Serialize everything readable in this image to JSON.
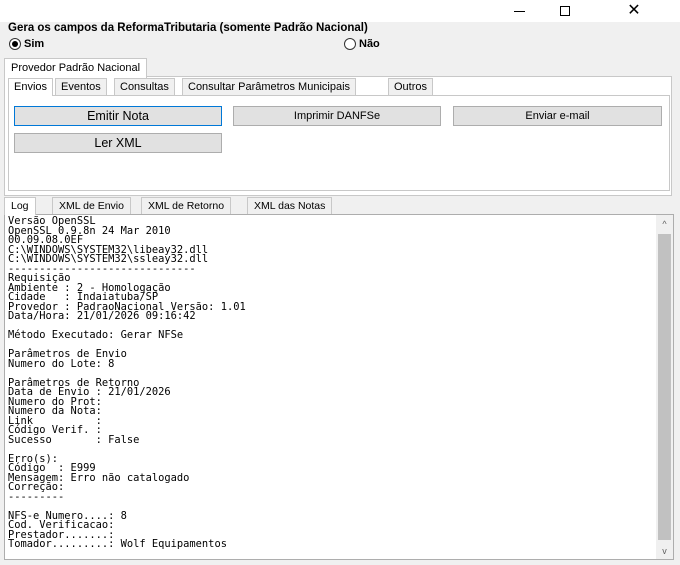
{
  "window": {
    "minimize_icon": "minimize-icon",
    "maximize_icon": "maximize-icon",
    "close_glyph": "✕"
  },
  "reforma": {
    "group_title": "Gera os campos da ReformaTributaria (somente Padrão Nacional)",
    "options": [
      {
        "label": "Sim",
        "selected": true
      },
      {
        "label": "Não",
        "selected": false
      }
    ]
  },
  "provider_tab": {
    "label": "Provedor Padrão Nacional"
  },
  "tabs": [
    {
      "label": "Envios",
      "active": true
    },
    {
      "label": "Eventos",
      "active": false
    },
    {
      "label": "Consultas",
      "active": false
    },
    {
      "label": "Consultar Parâmetros Municipais",
      "active": false
    },
    {
      "label": "Outros",
      "active": false
    }
  ],
  "buttons": {
    "emitir": "Emitir Nota",
    "imprimir": "Imprimir DANFSe",
    "enviar": "Enviar e-mail",
    "ler": "Ler XML"
  },
  "log_tabs": [
    {
      "label": "Log",
      "active": true
    },
    {
      "label": "XML de Envio",
      "active": false
    },
    {
      "label": "XML de Retorno",
      "active": false
    },
    {
      "label": "XML das Notas",
      "active": false
    }
  ],
  "log": {
    "lines": [
      "Versão OpenSSL",
      "OpenSSL 0.9.8n 24 Mar 2010",
      "00.09.08.0EF",
      "C:\\WINDOWS\\SYSTEM32\\libeay32.dll",
      "C:\\WINDOWS\\SYSTEM32\\ssleay32.dll",
      "------------------------------",
      "Requisição",
      "Ambiente : 2 - Homologação",
      "Cidade   : Indaiatuba/SP",
      "Provedor : PadraoNacional Versão: 1.01",
      "Data/Hora: 21/01/2026 09:16:42",
      "",
      "Método Executado: Gerar NFSe",
      "",
      "Parâmetros de Envio",
      "Numero do Lote: 8",
      "",
      "Parâmetros de Retorno",
      "Data de Envio : 21/01/2026",
      "Numero do Prot:",
      "Numero da Nota:",
      "Link          :",
      "Código Verif. :",
      "Sucesso       : False",
      "",
      "Erro(s):",
      "Código  : E999",
      "Mensagem: Erro não catalogado",
      "Correção:",
      "---------",
      "",
      "NFS-e Numero....: 8",
      "Cod. Verificacao:",
      "Prestador.......:",
      "Tomador.........: Wolf Equipamentos"
    ],
    "scroll_up_glyph": "^",
    "scroll_down_glyph": "v"
  }
}
